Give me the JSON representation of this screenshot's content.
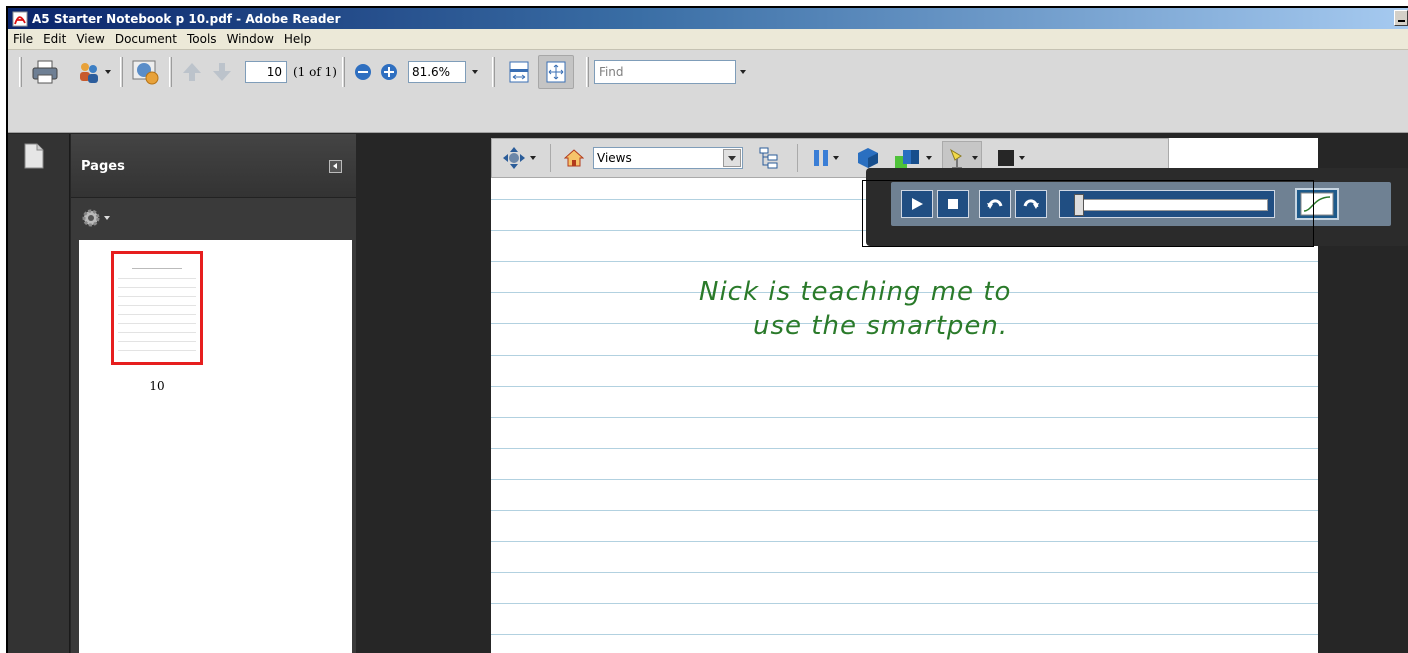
{
  "window": {
    "title": "A5 Starter Notebook p  10.pdf - Adobe Reader"
  },
  "menu": [
    "File",
    "Edit",
    "View",
    "Document",
    "Tools",
    "Window",
    "Help"
  ],
  "toolbar": {
    "page_number": "10",
    "page_count": "(1 of 1)",
    "zoom": "81.6%",
    "find_placeholder": "Find"
  },
  "nav": {
    "pages_title": "Pages",
    "thumbnail_label": "10"
  },
  "toolbar3d": {
    "views": "Views"
  },
  "handwriting": {
    "line1": "Nick is teaching me to",
    "line2": "use the smartpen."
  },
  "colors": {
    "ink": "#2a7a2a",
    "rule": "#b2d1e0",
    "thumb_border": "#e61e1e"
  }
}
